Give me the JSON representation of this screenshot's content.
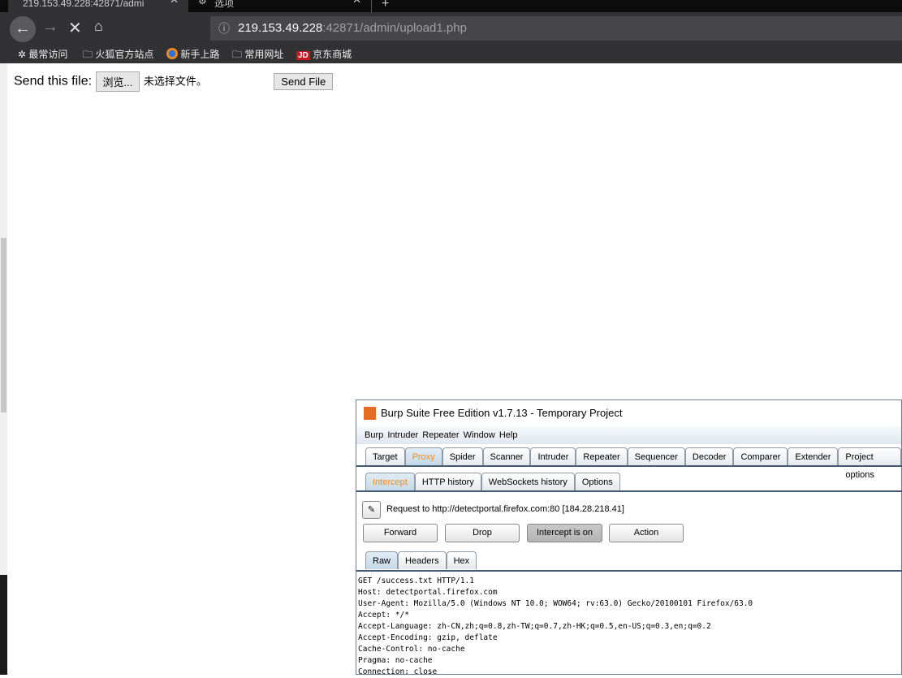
{
  "browser": {
    "tabs": [
      {
        "title": "219.153.49.228:42871/admi"
      },
      {
        "title": "选项"
      }
    ],
    "url_host": "219.153.49.228",
    "url_rest": ":42871/admin/upload1.php",
    "bookmarks": [
      "最常访问",
      "火狐官方站点",
      "新手上路",
      "常用网址",
      "京东商城"
    ],
    "jd_logo": "JD"
  },
  "page": {
    "label": "Send this file:",
    "browse": "浏览...",
    "no_file": "未选择文件。",
    "send": "Send File"
  },
  "burp": {
    "title": "Burp Suite Free Edition v1.7.13 - Temporary Project",
    "menu": [
      "Burp",
      "Intruder",
      "Repeater",
      "Window",
      "Help"
    ],
    "tabs": [
      "Target",
      "Proxy",
      "Spider",
      "Scanner",
      "Intruder",
      "Repeater",
      "Sequencer",
      "Decoder",
      "Comparer",
      "Extender",
      "Project options"
    ],
    "subtabs": [
      "Intercept",
      "HTTP history",
      "WebSockets history",
      "Options"
    ],
    "request_info": "Request to http://detectportal.firefox.com:80  [184.28.218.41]",
    "buttons": [
      "Forward",
      "Drop",
      "Intercept is on",
      "Action"
    ],
    "viewtabs": [
      "Raw",
      "Headers",
      "Hex"
    ],
    "request": "GET /success.txt HTTP/1.1\nHost: detectportal.firefox.com\nUser-Agent: Mozilla/5.0 (Windows NT 10.0; WOW64; rv:63.0) Gecko/20100101 Firefox/63.0\nAccept: */*\nAccept-Language: zh-CN,zh;q=0.8,zh-TW;q=0.7,zh-HK;q=0.5,en-US;q=0.3,en;q=0.2\nAccept-Encoding: gzip, deflate\nCache-Control: no-cache\nPragma: no-cache\nConnection: close"
  }
}
